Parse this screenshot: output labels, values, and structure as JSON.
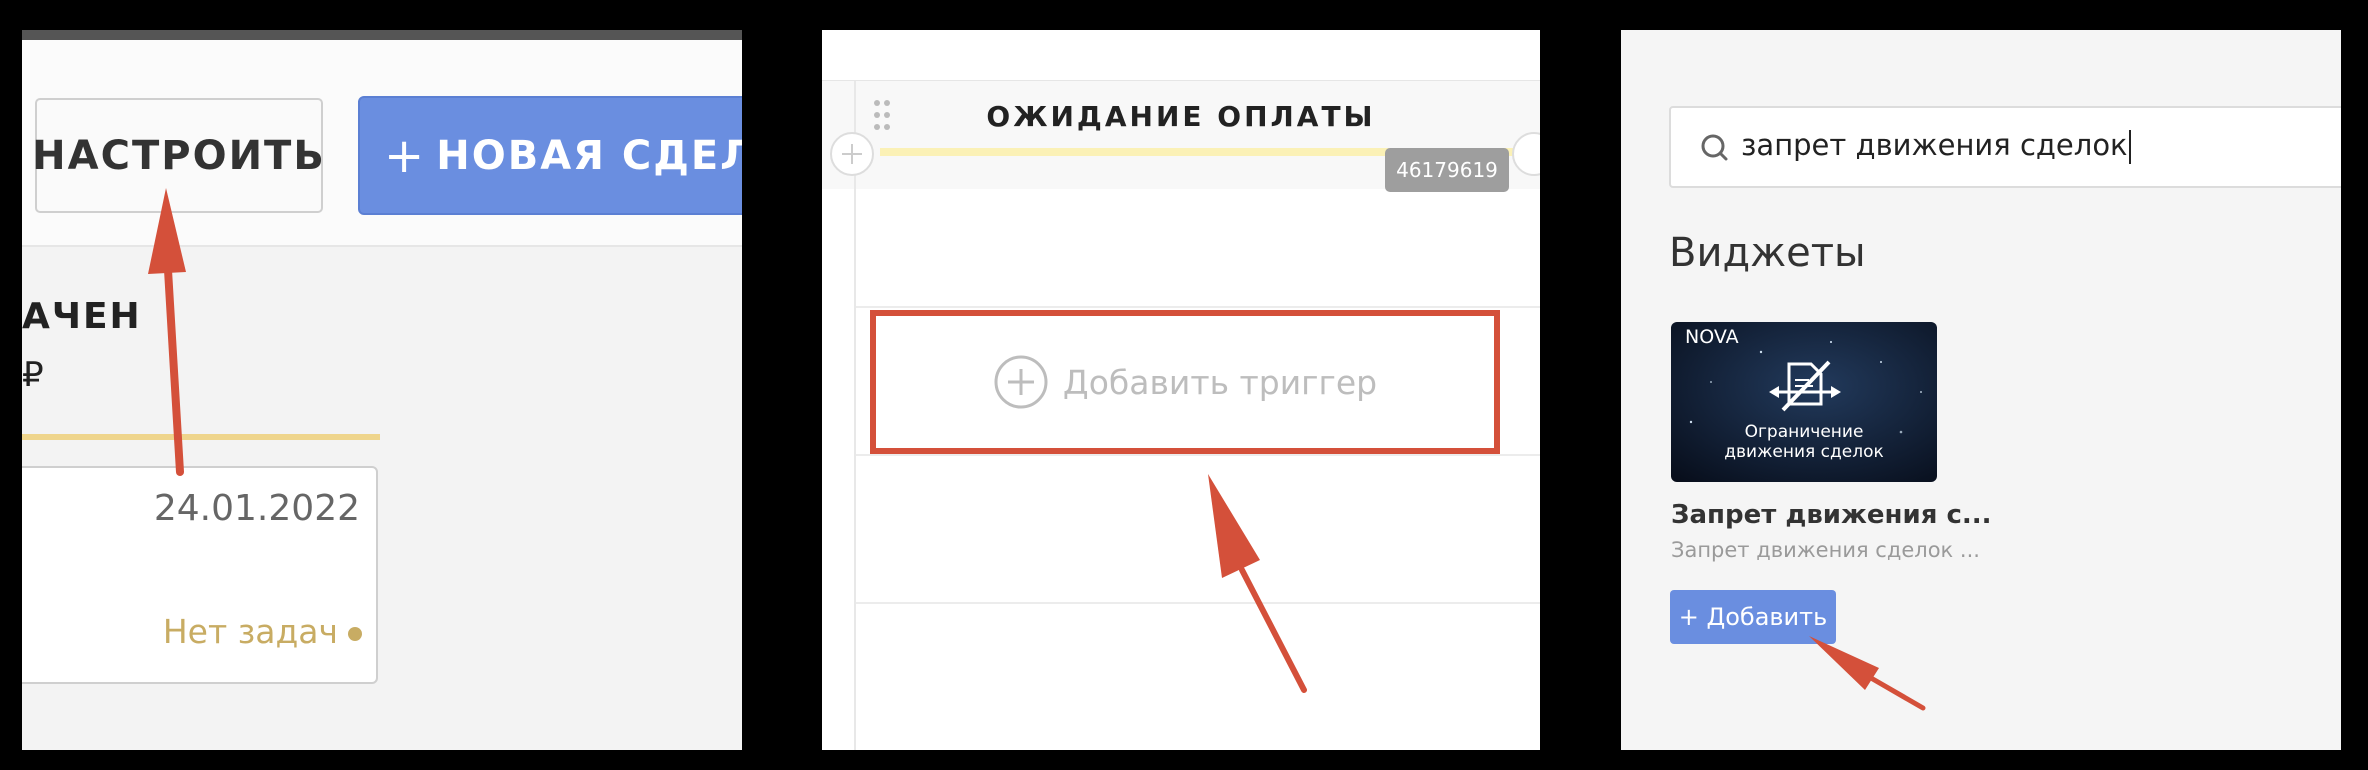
{
  "panel1": {
    "configure_label": "НАСТРОИТЬ",
    "new_deal_plus": "+",
    "new_deal_label": "НОВАЯ СДЕЛКА",
    "status_name": "АЧЕН",
    "status_sum": "₽",
    "card_date": "24.01.2022",
    "card_tasks": "Нет задач"
  },
  "panel2": {
    "stage_title": "ОЖИДАНИЕ ОПЛАТЫ",
    "stage_id": "46179619",
    "add_trigger_label": "Добавить триггер"
  },
  "panel3": {
    "search_value": "запрет движения сделок",
    "widgets_title": "Виджеты",
    "widget_brand": "NOVA",
    "widget_caption_line1": "Ограничение",
    "widget_caption_line2": "движения сделок",
    "widget_name": "Запрет движения с...",
    "widget_desc": "Запрет движения сделок ...",
    "add_button_label": "+ Добавить"
  },
  "colors": {
    "accent_blue": "#6a8ee0",
    "annotation_red": "#d4503a",
    "status_gold": "#c8ac63"
  },
  "icons": [
    "drag-handle-icon",
    "plus-circle-icon",
    "search-icon",
    "document-block-icon",
    "annotation-arrow"
  ]
}
